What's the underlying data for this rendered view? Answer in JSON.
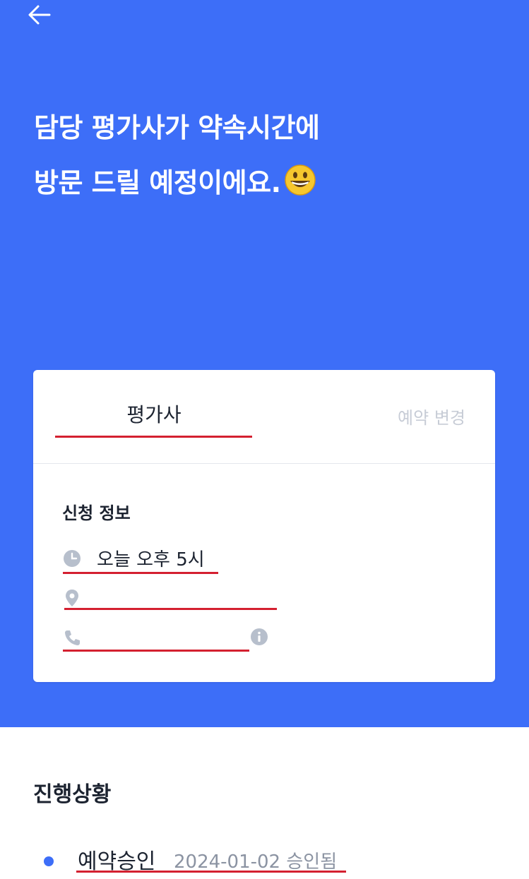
{
  "header": {
    "back_icon": "arrow-left-icon",
    "headline_line1": "담당 평가사가 약속시간에",
    "headline_line2": "방문 드릴 예정이에요.",
    "emoji": "grinning-face-emoji"
  },
  "card": {
    "tab_active": "평가사",
    "tab_change": "예약 변경",
    "info_title": "신청 정보",
    "time_icon": "clock-icon",
    "time_text": "오늘 오후 5시",
    "location_icon": "location-pin-icon",
    "location_text": "",
    "phone_icon": "phone-icon",
    "phone_text": "",
    "info_icon": "info-icon"
  },
  "progress": {
    "title": "진행상황",
    "items": [
      {
        "label": "예약승인",
        "date": "2024-01-02 승인됨"
      }
    ]
  },
  "colors": {
    "brand": "#3d6ef8",
    "underline": "#d42030"
  }
}
